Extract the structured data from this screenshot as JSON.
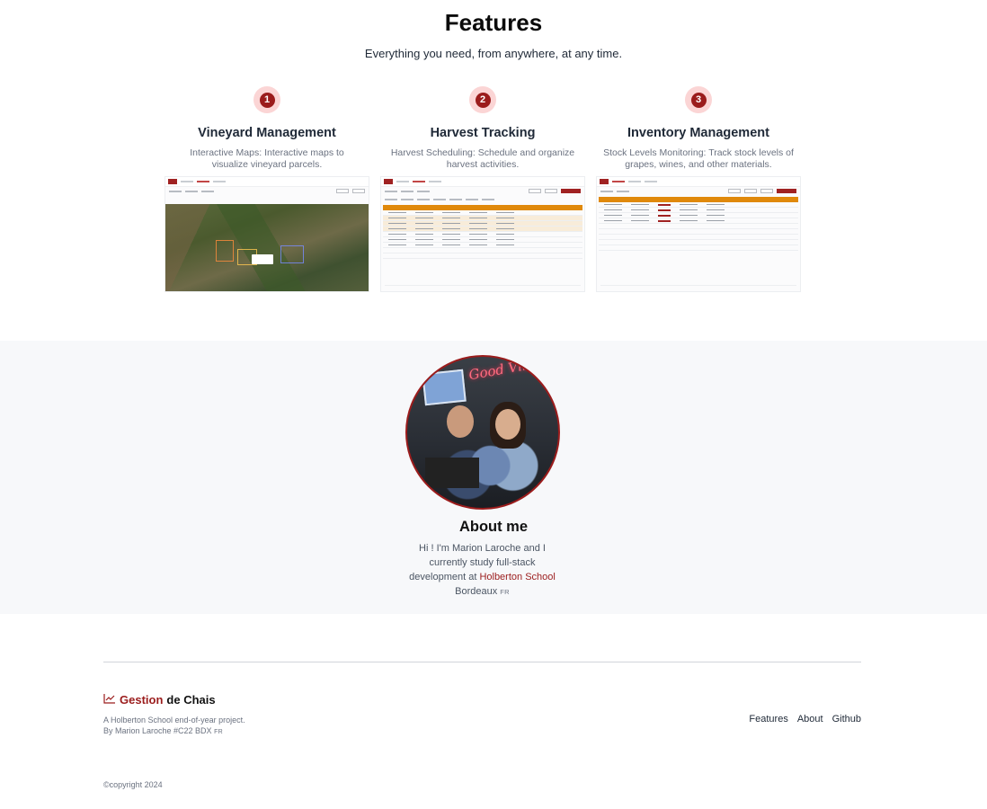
{
  "features": {
    "title": "Features",
    "subtitle": "Everything you need, from anywhere, at any time.",
    "items": [
      {
        "number": "1",
        "title": "Vineyard Management",
        "description": "Interactive Maps: Interactive maps to visualize vineyard parcels."
      },
      {
        "number": "2",
        "title": "Harvest Tracking",
        "description": "Harvest Scheduling: Schedule and organize harvest activities."
      },
      {
        "number": "3",
        "title": "Inventory Management",
        "description": "Stock Levels Monitoring: Track stock levels of grapes, wines, and other materials."
      }
    ]
  },
  "about": {
    "title": "About me",
    "bio_prefix": "Hi ! I'm Marion Laroche and I currently study full-stack development at ",
    "bio_link": "Holberton School",
    "bio_city": "Bordeaux",
    "bio_flag": "FR"
  },
  "footer": {
    "brand_highlight": "Gestion",
    "brand_rest": "de Chais",
    "tagline_line1": "A Holberton School end-of-year project.",
    "tagline_line2": "By Marion Laroche #C22 BDX",
    "tagline_flag": "FR",
    "nav": [
      "Features",
      "About",
      "Github"
    ],
    "copyright": "©copyright 2024"
  },
  "colors": {
    "accent": "#9b1c1c",
    "accent_soft": "#fbd5d5",
    "about_bg": "#f7f8fa",
    "table_header": "#e0890b"
  },
  "icons": {
    "brand": "chart-line-icon"
  }
}
